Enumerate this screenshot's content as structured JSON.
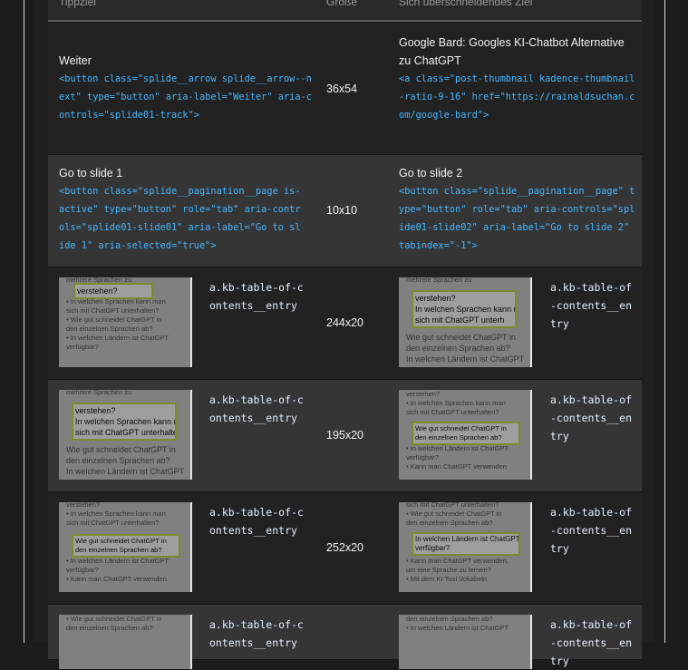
{
  "header": {
    "col1": "Tippziel",
    "col2": "Größe",
    "col3": "Sich überschneidendes Ziel"
  },
  "rows": [
    {
      "a_title": "Weiter",
      "a_code": "<button class=\"splide__arrow splide__arrow--next\" type=\"button\" aria-label=\"Weiter\" aria-controls=\"splide01-track\">",
      "size": "36x54",
      "b_title": "Google Bard: Googles KI-Chatbot Alternative zu ChatGPT",
      "b_code": "<a class=\"post-thumbnail kadence-thumbnail-ratio-9-16\" href=\"https://rainaldsuchan.com/google-bard\">"
    },
    {
      "a_title": "Go to slide 1",
      "a_code": "<button class=\"splide__pagination__page is-active\" type=\"button\" role=\"tab\" aria-controls=\"splide01-slide01\" aria-label=\"Go to slide 1\" aria-selected=\"true\">",
      "size": "10x10",
      "b_title": "Go to slide 2",
      "b_code": "<button class=\"splide__pagination__page\" type=\"button\" role=\"tab\" aria-controls=\"splide01-slide02\" aria-label=\"Go to slide 2\" tabindex=\"-1\">"
    },
    {
      "a_sel": "a.kb-table-of-contents__entry",
      "size": "244x20",
      "b_sel": "a.kb-table-of-contents__entry",
      "thumb_a": {
        "lines_top": [
          "mehrere Sprachen zu"
        ],
        "hl": [
          "verstehen?"
        ],
        "lines_bottom": [
          "• In welchen Sprachen kann man",
          "sich mit ChatGPT unterhalten?",
          "• Wie gut schneidet ChatGPT in",
          "den einzelnen Sprachen ab?",
          "• In welchen Ländern ist ChatGPT",
          "verfügbar?"
        ]
      },
      "thumb_b": {
        "lines_top": [
          "mehrere Sprachen zu"
        ],
        "hl": [
          "verstehen?",
          "In welchen Sprachen kann man",
          "sich mit ChatGPT unterh"
        ],
        "lines_bottom": [
          "Wie gut schneidet ChatGPT in",
          "den einzelnen Sprachen ab?",
          "In welchen Ländern ist ChatGPT"
        ]
      }
    },
    {
      "a_sel": "a.kb-table-of-contents__entry",
      "size": "195x20",
      "b_sel": "a.kb-table-of-contents__entry",
      "thumb_a": {
        "lines_top": [
          "mehrere Sprachen zu"
        ],
        "hl": [
          "verstehen?",
          "In welchen Sprachen kann man",
          "sich mit ChatGPT unterhalten"
        ],
        "lines_bottom": [
          "Wie gut schneidet ChatGPT in",
          "den einzelnen Sprachen ab?",
          "In welchen Ländern ist ChatGPT"
        ]
      },
      "thumb_b": {
        "lines_top": [
          "verstehen?",
          "• In welchen Sprachen kann man",
          "sich mit ChatGPT unterhalten?"
        ],
        "hl": [
          "Wie gut schneidet ChatGPT in",
          "den einzelnen Sprachen ab?"
        ],
        "lines_bottom": [
          "• In welchen Ländern ist ChatGPT",
          "verfügbar?",
          "• Kann man ChatGPT verwenden"
        ]
      }
    },
    {
      "a_sel": "a.kb-table-of-contents__entry",
      "size": "252x20",
      "b_sel": "a.kb-table-of-contents__entry",
      "thumb_a": {
        "lines_top": [
          "verstehen?",
          "• In welchen Sprachen kann man",
          "sich mit ChatGPT unterhalten?"
        ],
        "hl": [
          "Wie gut schneidet ChatGPT in",
          "den einzelnen Sprachen ab?"
        ],
        "lines_bottom": [
          "• In welchen Ländern ist ChatGPT",
          "verfügbar?",
          "• Kann man ChatGPT verwenden"
        ]
      },
      "thumb_b": {
        "lines_top": [
          "sich mit ChatGPT unterhalten?",
          "• Wie gut schneidet ChatGPT in",
          "den einzelnen Sprachen ab?"
        ],
        "hl": [
          "In welchen Ländern ist ChatGPT",
          "verfügbar?"
        ],
        "lines_bottom": [
          "• Kann man ChatGPT verwenden,",
          "um eine Sprache zu lernen?",
          "• Mit dem KI Tool Vokabeln"
        ]
      }
    },
    {
      "a_sel": "a.kb-table-of-contents__entry",
      "b_sel": "a.kb-table-of-contents__entry",
      "thumb_a": {
        "lines_top": [
          "• Wie gut schneidet ChatGPT in",
          "den einzelnen Sprachen ab?"
        ],
        "hl": [],
        "lines_bottom": []
      },
      "thumb_b": {
        "lines_top": [
          "den einzelnen Sprachen ab?",
          "• In welchen Ländern ist ChatGPT"
        ],
        "hl": [],
        "lines_bottom": []
      }
    }
  ]
}
